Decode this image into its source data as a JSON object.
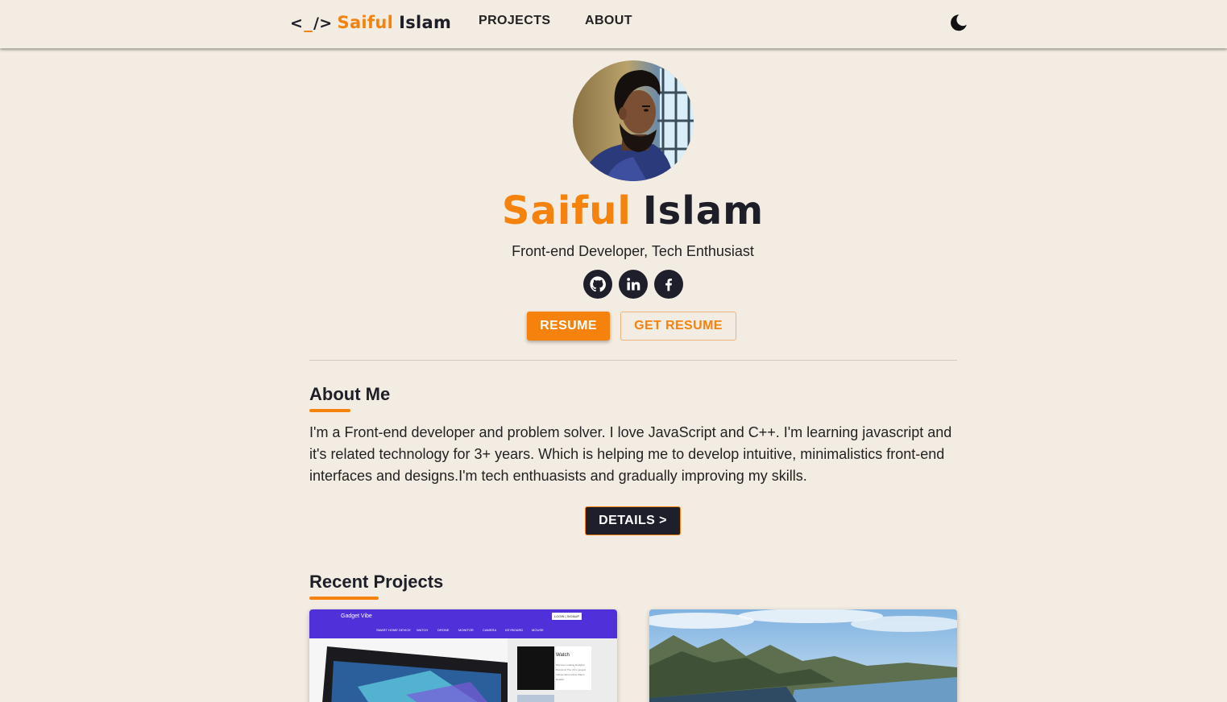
{
  "header": {
    "logo": {
      "open": "<",
      "underscore": "_",
      "close": "/>",
      "first": "Saiful",
      "last": "Islam"
    },
    "nav": [
      {
        "label": "PROJECTS"
      },
      {
        "label": "ABOUT"
      }
    ],
    "theme_icon": "moon-icon"
  },
  "hero": {
    "avatar_icon": "profile-photo",
    "name_first": "Saiful",
    "name_last": "Islam",
    "tagline": "Front-end Developer, Tech Enthusiast",
    "socials": [
      "github-icon",
      "linkedin-icon",
      "facebook-icon"
    ],
    "resume_label": "RESUME",
    "get_resume_label": "GET RESUME"
  },
  "about": {
    "title": "About Me",
    "text": "I'm a Front-end developer and problem solver. I love JavaScript and C++. I'm learning javascript and it's related technology for 3+ years. Which is helping me to develop intuitive, minimalistics front-end interfaces and designs.I'm tech enthuasists and gradually improving my skills.",
    "details_label": "DETAILS >"
  },
  "projects": {
    "title": "Recent Projects",
    "cards": [
      {
        "site_name": "Gadget Vibe",
        "login_label": "LOGIN | SIGNUP",
        "menu": [
          "SMART HOME DEVICE",
          "WATCH",
          "DRONE",
          "MONITOR",
          "CAMERA",
          "KEYBOARD",
          "MOUSE"
        ],
        "item_title": "Watch",
        "item_desc": "Discover Leading Designer Brands At The UK's Largest Independent Online Watch Retailer"
      },
      {
        "image": "mountain-lake-landscape"
      }
    ]
  },
  "colors": {
    "accent": "#f5820d",
    "dark": "#1f1f2b",
    "background": "#f3ece2",
    "card_header": "#5030d8"
  }
}
